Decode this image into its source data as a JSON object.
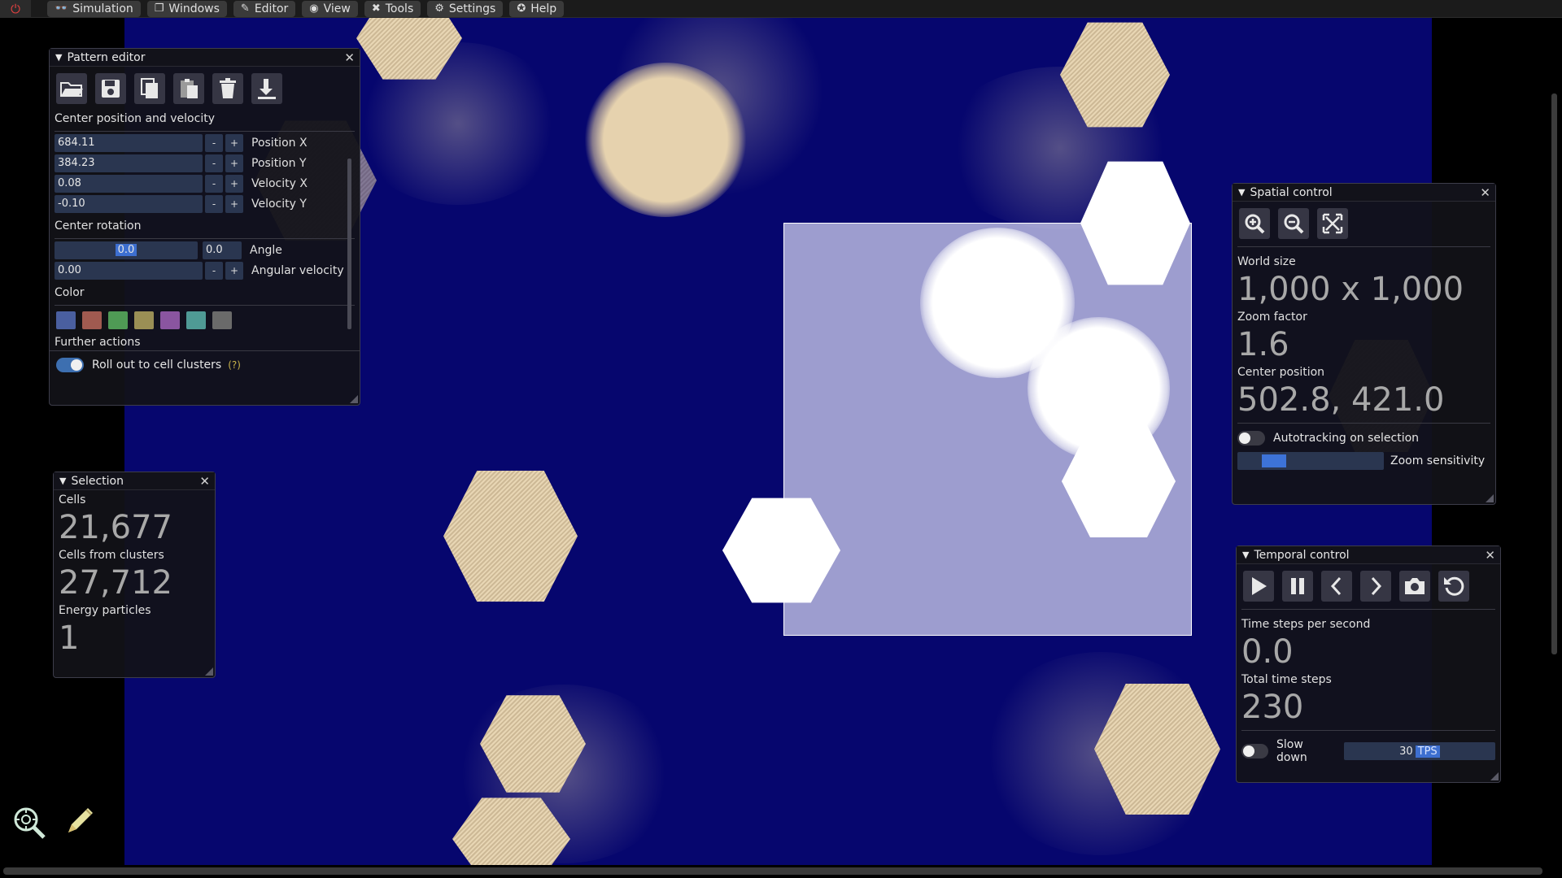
{
  "menu": {
    "items": [
      {
        "label": "Simulation",
        "icon": "glasses-icon",
        "glyph": "👓"
      },
      {
        "label": "Windows",
        "icon": "windows-icon",
        "glyph": "❐"
      },
      {
        "label": "Editor",
        "icon": "pencil-icon",
        "glyph": "✎"
      },
      {
        "label": "View",
        "icon": "eye-icon",
        "glyph": "◉"
      },
      {
        "label": "Tools",
        "icon": "tools-icon",
        "glyph": "✖"
      },
      {
        "label": "Settings",
        "icon": "gear-icon",
        "glyph": "⚙"
      },
      {
        "label": "Help",
        "icon": "help-icon",
        "glyph": "✪"
      }
    ]
  },
  "pattern_editor": {
    "title": "Pattern editor",
    "toolbar_icons": [
      "folder-open-icon",
      "save-icon",
      "copy-icon",
      "paste-icon",
      "delete-icon",
      "download-icon"
    ],
    "center_section": "Center position and velocity",
    "fields": [
      {
        "value": "684.11",
        "label": "Position X"
      },
      {
        "value": "384.23",
        "label": "Position Y"
      },
      {
        "value": "0.08",
        "label": "Velocity X"
      },
      {
        "value": "-0.10",
        "label": "Velocity Y"
      }
    ],
    "rotation_section": "Center rotation",
    "angle_slider_value": "0.0",
    "angle_value": "0.0",
    "angle_label": "Angle",
    "angular_velocity_value": "0.00",
    "angular_velocity_label": "Angular velocity",
    "minus": "-",
    "plus": "+",
    "color_section": "Color",
    "colors": [
      "#4a5fa0",
      "#a05a50",
      "#4f9a55",
      "#9a8f55",
      "#8a55a0",
      "#4f9a95",
      "#6a6a6a"
    ],
    "further_actions": "Further actions",
    "rollout_label": "Roll out to cell clusters",
    "rollout_help": "(?)",
    "rollout_enabled": true
  },
  "selection": {
    "title": "Selection",
    "cells_label": "Cells",
    "cells_value": "21,677",
    "clusters_label": "Cells from clusters",
    "clusters_value": "27,712",
    "energy_label": "Energy particles",
    "energy_value": "1"
  },
  "spatial": {
    "title": "Spatial control",
    "icons": [
      "zoom-in-icon",
      "zoom-out-icon",
      "fit-screen-icon"
    ],
    "world_size_label": "World size",
    "world_size_value": "1,000 x 1,000",
    "zoom_label": "Zoom factor",
    "zoom_value": "1.6",
    "center_label": "Center position",
    "center_value": "502.8, 421.0",
    "autotrack_label": "Autotracking on selection",
    "autotrack_enabled": false,
    "zoom_sensitivity_label": "Zoom sensitivity"
  },
  "temporal": {
    "title": "Temporal control",
    "icons": [
      "play-icon",
      "pause-icon",
      "step-back-icon",
      "step-forward-icon",
      "snapshot-icon",
      "restore-icon"
    ],
    "tps_label": "Time steps per second",
    "tps_value": "0.0",
    "total_label": "Total time steps",
    "total_value": "230",
    "slowdown_label": "Slow down",
    "slowdown_enabled": false,
    "slowdown_value": "30",
    "slowdown_unit": "TPS"
  },
  "bottom_left_icons": [
    "search-icon",
    "pencil-icon"
  ]
}
